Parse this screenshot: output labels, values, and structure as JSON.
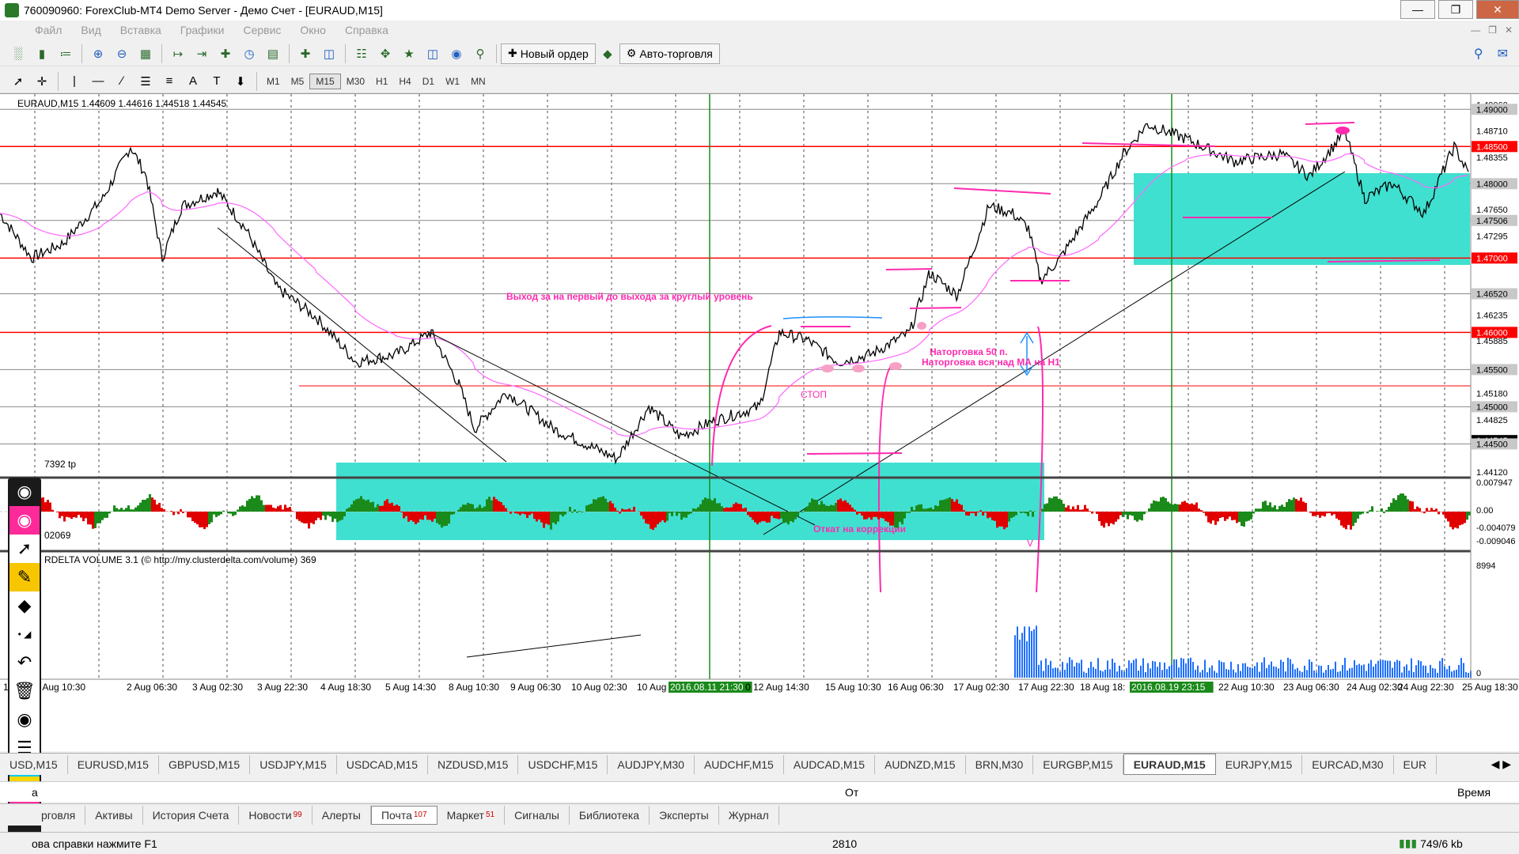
{
  "window": {
    "title": "760090960: ForexClub-MT4 Demo Server - Демо Счет - [EURAUD,M15]"
  },
  "menu": [
    "Файл",
    "Вид",
    "Вставка",
    "Графики",
    "Сервис",
    "Окно",
    "Справка"
  ],
  "toolbar": {
    "new_order": "Новый ордер",
    "autotrade": "Авто-торговля"
  },
  "timeframes": [
    "M1",
    "M5",
    "M15",
    "M30",
    "H1",
    "H4",
    "D1",
    "W1",
    "MN"
  ],
  "active_timeframe": "M15",
  "chart": {
    "header": "EURAUD,M15  1.44609 1.44616 1.44518 1.44545",
    "price_labels": [
      "1.49060",
      "1.49000",
      "1.48710",
      "1.48500",
      "1.48355",
      "1.48000",
      "1.47650",
      "1.47506",
      "1.47295",
      "1.47000",
      "1.46520",
      "1.46235",
      "1.46000",
      "1.45885",
      "1.45500",
      "1.45180",
      "1.45000",
      "1.44825",
      "1.44545",
      "1.44500",
      "1.44120"
    ],
    "highlighted_levels": [
      "1.49000",
      "1.48500",
      "1.48000",
      "1.47506",
      "1.47000",
      "1.46520",
      "1.46000",
      "1.45500",
      "1.45000",
      "1.44500"
    ],
    "red_levels": [
      "1.48500",
      "1.47000",
      "1.46000"
    ],
    "bid_label": "1.44545",
    "time_labels": [
      "16",
      "1 Aug 10:30",
      "2 Aug 06:30",
      "3 Aug 02:30",
      "3 Aug 22:30",
      "4 Aug 18:30",
      "5 Aug 14:30",
      "8 Aug 10:30",
      "9 Aug 06:30",
      "10 Aug 02:30",
      "10 Aug",
      "2016.08.11 21:30",
      "0 12 Aug 14:30",
      "15 Aug 10:30",
      "16 Aug 06:30",
      "17 Aug 02:30",
      "17 Aug 22:30",
      "18 Aug 18:",
      "2016.08.19 23:15",
      "22 Aug 10:30",
      "23 Aug 06:30",
      "24 Aug 02:30",
      "24 Aug 22:30",
      "25 Aug 18:30"
    ],
    "tp_label": "7392 tp",
    "osc_label": "02069",
    "osc_scale": [
      "0.007947",
      "0.00",
      "-0.004079",
      "-0.009046"
    ],
    "volume_label": "RDELTA VOLUME 3.1 (© http://my.clusterdelta.com/volume) 369",
    "volume_scale": [
      "8994",
      "0"
    ],
    "annotations": {
      "exit": "Выход за на первый до выхода за круглый уровень",
      "build1": "Наторговка 50 п.",
      "build2": "Наторговка вся над МА на Н1",
      "stop": "СТОП",
      "pullback": "Откат на коррекции",
      "v": "V"
    },
    "colors": {
      "zone": "#40e0d0",
      "level": "#ff0000",
      "annot": "#ff2aaf",
      "ma": "#ff66ff"
    }
  },
  "symbol_tabs": [
    "USD,M15",
    "EURUSD,M15",
    "GBPUSD,M15",
    "USDJPY,M15",
    "USDCAD,M15",
    "NZDUSD,M15",
    "USDCHF,M15",
    "AUDJPY,M30",
    "AUDCHF,M15",
    "AUDCAD,M15",
    "AUDNZD,M15",
    "BRN,M30",
    "EURGBP,M15",
    "EURAUD,M15",
    "EURJPY,M15",
    "EURCAD,M30",
    "EUR"
  ],
  "active_symbol": "EURAUD,M15",
  "terminal_header": {
    "col1": "а",
    "col2": "От",
    "col3": "Время"
  },
  "terminal_tabs": [
    {
      "label": "рговля",
      "badge": ""
    },
    {
      "label": "Активы",
      "badge": ""
    },
    {
      "label": "История Счета",
      "badge": ""
    },
    {
      "label": "Новости",
      "badge": "99"
    },
    {
      "label": "Алерты",
      "badge": ""
    },
    {
      "label": "Почта",
      "badge": "107"
    },
    {
      "label": "Маркет",
      "badge": "51"
    },
    {
      "label": "Сигналы",
      "badge": ""
    },
    {
      "label": "Библиотека",
      "badge": ""
    },
    {
      "label": "Эксперты",
      "badge": ""
    },
    {
      "label": "Журнал",
      "badge": ""
    }
  ],
  "status": {
    "help": "ова справки нажмите F1",
    "bars": "2810",
    "traffic": "749/6 kb"
  }
}
